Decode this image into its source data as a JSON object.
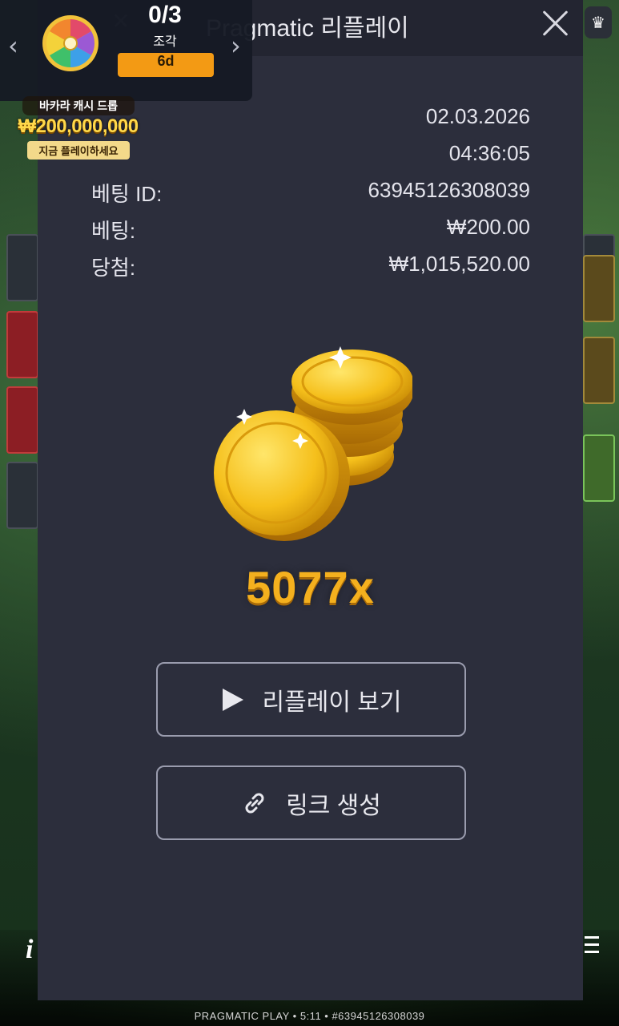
{
  "event_widget": {
    "count": "0/3",
    "unit": "조각",
    "timer": "6d",
    "prev_icon": "chevron-left-icon",
    "next_icon": "chevron-right-icon",
    "wheel_icon": "prize-wheel-icon"
  },
  "promo": {
    "line1": "바카라 캐시 드롭",
    "amount": "₩200,000,000",
    "line2": "지금 플레이하세요"
  },
  "modal": {
    "title": "Pragmatic 리플레이",
    "close_icon": "close-icon",
    "details": [
      {
        "label": "",
        "value": "02.03.2026"
      },
      {
        "label": "",
        "value": "04:36:05"
      },
      {
        "label": "베팅 ID:",
        "value": "63945126308039"
      },
      {
        "label": "베팅:",
        "value": "₩200.00"
      },
      {
        "label": "당첨:",
        "value": "₩1,015,520.00"
      }
    ],
    "multiplier": "5077x",
    "buttons": {
      "watch_replay": "리플레이 보기",
      "create_link": "링크 생성"
    }
  },
  "footer": {
    "text": "PRAGMATIC PLAY • 5:11 • #63945126308039"
  },
  "colors": {
    "modal_bg": "#2c2e3c",
    "header_bg": "#232531",
    "multiplier": "#f4b01e",
    "timer_badge": "#f39a14"
  }
}
